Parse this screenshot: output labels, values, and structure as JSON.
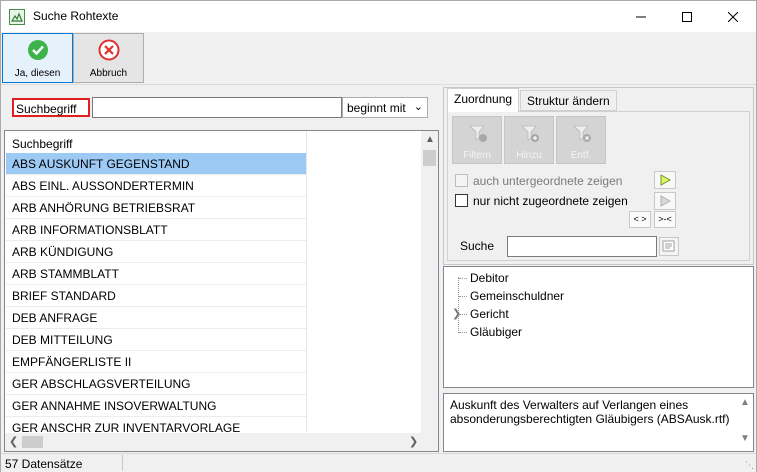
{
  "window": {
    "title": "Suche Rohtexte"
  },
  "toolbar": {
    "ok_label": "Ja, diesen",
    "cancel_label": "Abbruch"
  },
  "search": {
    "label": "Suchbegriff",
    "value": "",
    "mode": "beginnt mit"
  },
  "list": {
    "header": "Suchbegriff",
    "items": [
      "ABS AUSKUNFT GEGENSTAND",
      "ABS EINL. AUSSONDERTERMIN",
      "ARB ANHÖRUNG BETRIEBSRAT",
      "ARB INFORMATIONSBLATT",
      "ARB KÜNDIGUNG",
      "ARB STAMMBLATT",
      "BRIEF STANDARD",
      "DEB ANFRAGE",
      "DEB MITTEILUNG",
      "EMPFÄNGERLISTE II",
      "GER ABSCHLAGSVERTEILUNG",
      "GER ANNAHME INSOVERWALTUNG",
      "GER ANSCHR ZUR INVENTARVORLAGE"
    ],
    "selected_index": 0
  },
  "tabs": [
    {
      "label": "Zuordnung",
      "active": true
    },
    {
      "label": "Struktur ändern",
      "active": false
    }
  ],
  "assign": {
    "buttons": [
      {
        "label": "Filtern",
        "icon": "filter-icon"
      },
      {
        "label": "Hinzu",
        "icon": "add-icon"
      },
      {
        "label": "Entf.",
        "icon": "remove-icon"
      }
    ],
    "check_sub": {
      "label": "auch untergeordnete zeigen",
      "checked": false,
      "enabled": false
    },
    "check_unassigned": {
      "label": "nur nicht zugeordnete zeigen",
      "checked": false,
      "enabled": true
    },
    "expand_label": "< >",
    "collapse_label": ">-<",
    "search_label": "Suche",
    "search_value": ""
  },
  "tree": {
    "items": [
      "Debitor",
      "Gemeinschuldner",
      "Gericht",
      "Gläubiger"
    ]
  },
  "description": "Auskunft des Verwalters auf Verlangen eines absonderungsberechtigten Gläubigers (ABSAusk.rtf)",
  "status": {
    "count_text": "57 Datensätze"
  },
  "colors": {
    "selection": "#9dcaf5",
    "ok_icon": "#2eaa3c",
    "cancel_icon": "#e03030",
    "search_label_border": "#e02020"
  }
}
